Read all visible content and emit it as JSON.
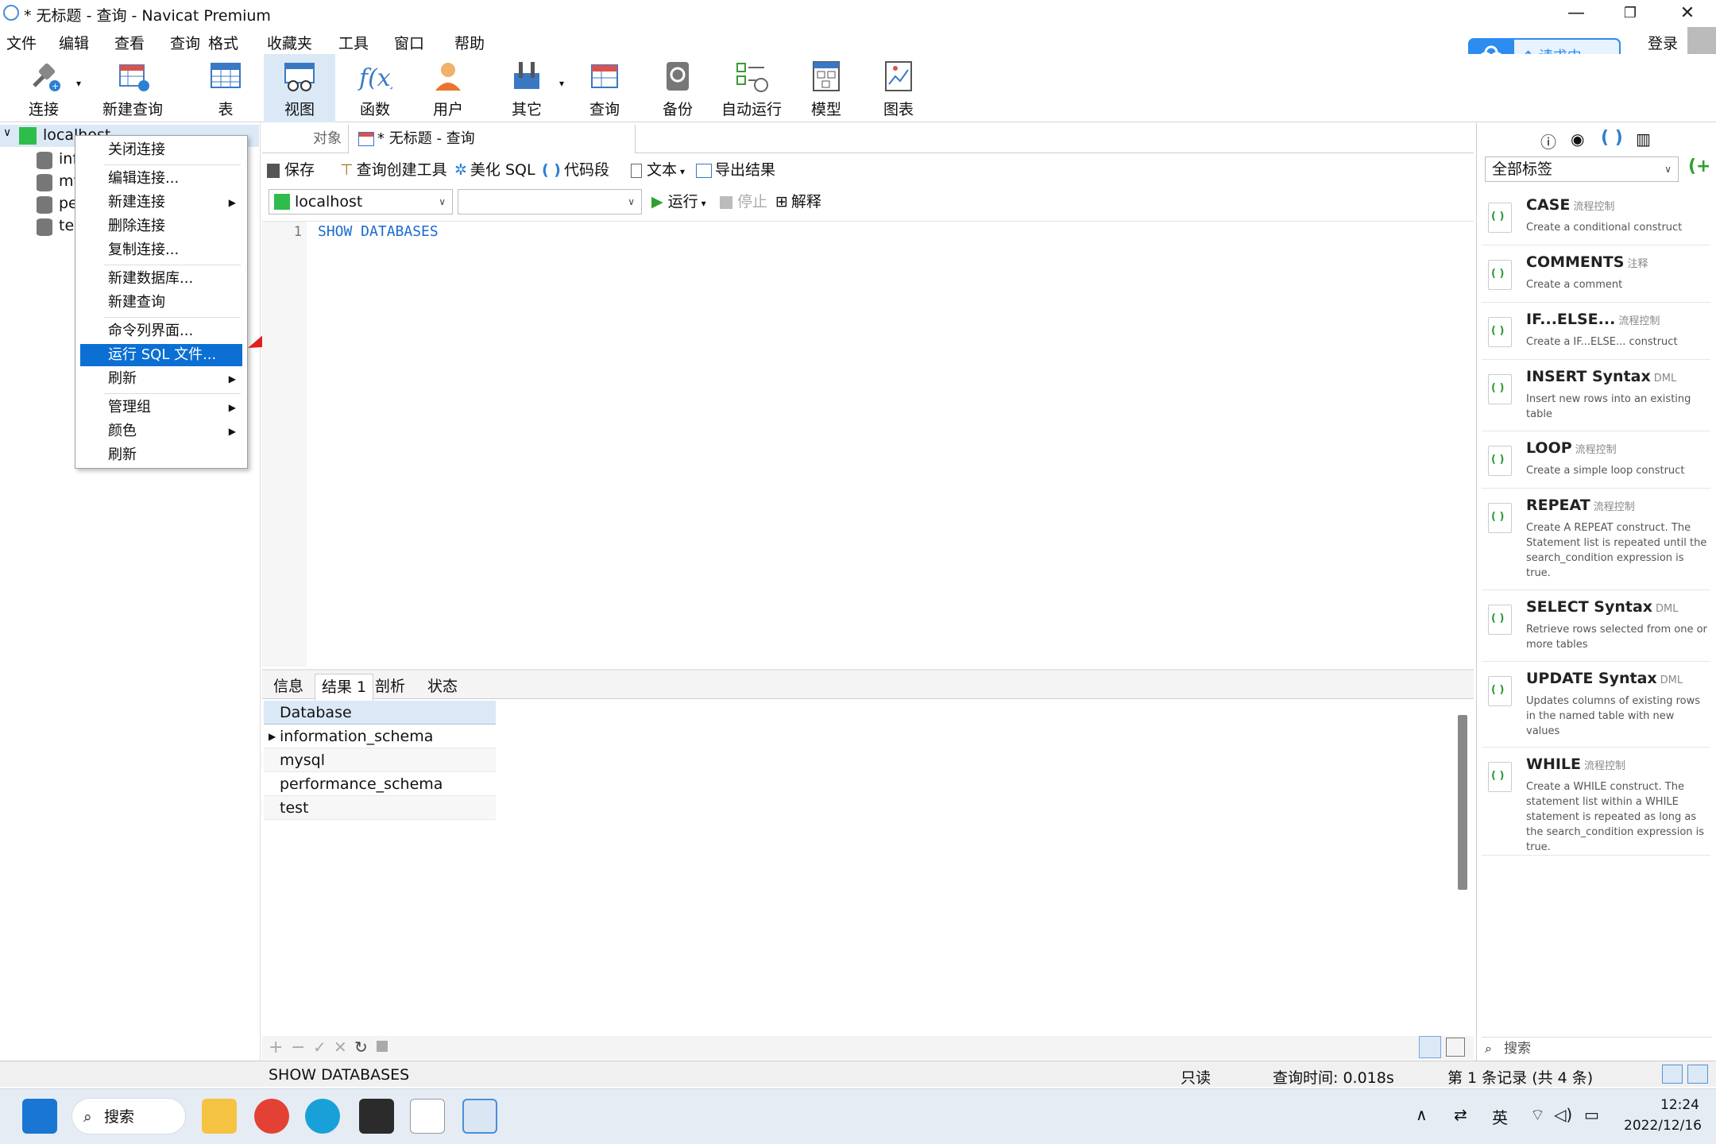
{
  "window": {
    "title": "* 无标题 - 查询 - Navicat Premium",
    "minimize": "—",
    "maximize": "❐",
    "close": "✕"
  },
  "menu": [
    "文件",
    "编辑",
    "查看",
    "查询",
    "格式",
    "收藏夹",
    "工具",
    "窗口",
    "帮助"
  ],
  "toolbar": {
    "items": [
      "连接",
      "新建查询",
      "表",
      "视图",
      "函数",
      "用户",
      "其它",
      "查询",
      "备份",
      "自动运行",
      "模型",
      "图表"
    ],
    "active": "视图"
  },
  "cloud": {
    "label": "请求中"
  },
  "login": "登录",
  "tree": {
    "connection": "localhost",
    "databases": [
      "inf",
      "my",
      "pe",
      "tes"
    ]
  },
  "context_menu": {
    "items": [
      "关闭连接",
      "编辑连接...",
      "新建连接",
      "删除连接",
      "复制连接...",
      "新建数据库...",
      "新建查询",
      "命令列界面...",
      "运行 SQL 文件...",
      "刷新",
      "管理组",
      "颜色",
      "刷新"
    ],
    "highlighted": "运行 SQL 文件..."
  },
  "tabs": {
    "object": "对象",
    "query": "* 无标题 - 查询"
  },
  "editor_toolbar": {
    "save": "保存",
    "builder": "查询创建工具",
    "beautify": "美化 SQL",
    "snippet": "代码段",
    "text": "文本",
    "export": "导出结果"
  },
  "connection_row": {
    "connection": "localhost",
    "database": "",
    "run": "运行",
    "stop": "停止",
    "explain": "解释"
  },
  "editor": {
    "line": "1",
    "code": "SHOW DATABASES"
  },
  "result_tabs": [
    "信息",
    "结果 1",
    "剖析",
    "状态"
  ],
  "result_tab_active": "结果 1",
  "grid": {
    "header": "Database",
    "rows": [
      "information_schema",
      "mysql",
      "performance_schema",
      "test"
    ]
  },
  "right_panel": {
    "filter": "全部标签",
    "search_placeholder": "搜索",
    "snippets": [
      {
        "title": "CASE",
        "tag": "流程控制",
        "desc": "Create a conditional construct"
      },
      {
        "title": "COMMENTS",
        "tag": "注释",
        "desc": "Create a comment"
      },
      {
        "title": "IF...ELSE...",
        "tag": "流程控制",
        "desc": "Create a IF...ELSE... construct"
      },
      {
        "title": "INSERT Syntax",
        "tag": "DML",
        "desc": "Insert new rows into an existing table"
      },
      {
        "title": "LOOP",
        "tag": "流程控制",
        "desc": "Create a simple loop construct"
      },
      {
        "title": "REPEAT",
        "tag": "流程控制",
        "desc": "Create A REPEAT construct. The Statement list is repeated until the search_condition expression is true."
      },
      {
        "title": "SELECT Syntax",
        "tag": "DML",
        "desc": "Retrieve rows selected from one or more tables"
      },
      {
        "title": "UPDATE Syntax",
        "tag": "DML",
        "desc": "Updates columns of existing rows in the named table with new values"
      },
      {
        "title": "WHILE",
        "tag": "流程控制",
        "desc": "Create a WHILE construct. The statement list within a WHILE statement is repeated as long as the search_condition expression is true."
      }
    ]
  },
  "status": {
    "sql": "SHOW DATABASES",
    "readonly": "只读",
    "query_time": "查询时间: 0.018s",
    "records": "第 1 条记录 (共 4 条)"
  },
  "taskbar": {
    "search": "搜索",
    "ime": "英",
    "time": "12:24",
    "date": "2022/12/16"
  }
}
